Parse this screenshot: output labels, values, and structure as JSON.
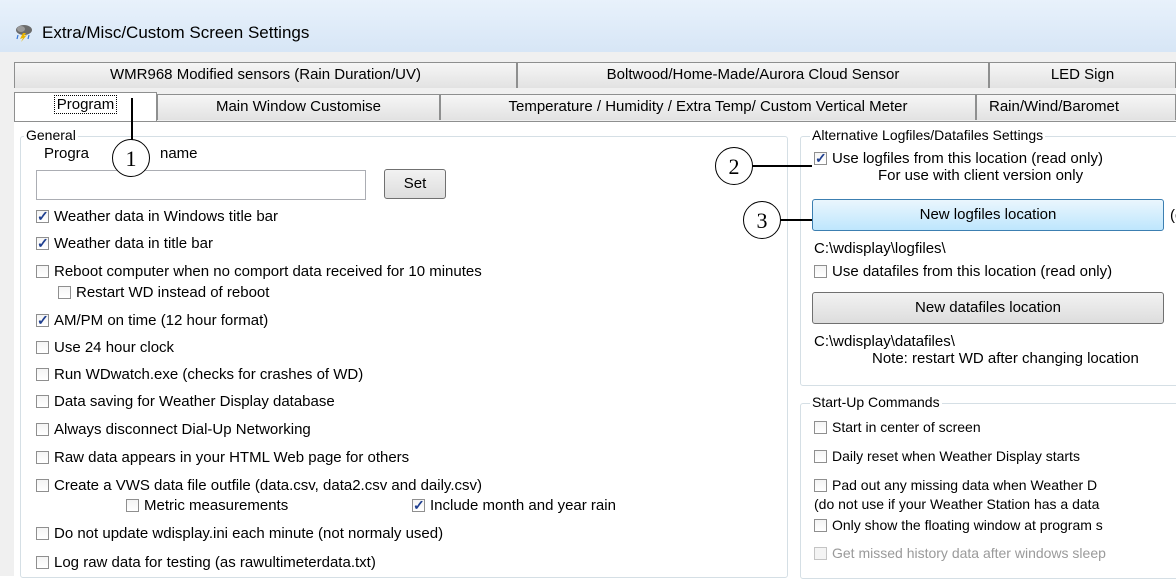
{
  "window": {
    "title": "Extra/Misc/Custom Screen Settings",
    "icon": "weather-app-icon"
  },
  "tabs_row1": [
    {
      "label": "WMR968 Modified sensors (Rain Duration/UV)"
    },
    {
      "label": "Boltwood/Home-Made/Aurora Cloud Sensor"
    },
    {
      "label": "LED Sign"
    }
  ],
  "tabs_row2": [
    {
      "label": "Program",
      "active": true
    },
    {
      "label": "Main Window Customise"
    },
    {
      "label": "Temperature / Humidity / Extra Temp/ Custom Vertical Meter"
    },
    {
      "label": "Rain/Wind/Baromet"
    }
  ],
  "general": {
    "group_label": "General",
    "program_name_label_left": "Progra",
    "program_name_label_right": "name",
    "program_name_value": "",
    "set_button": "Set",
    "options": [
      {
        "label": "Weather data in Windows title bar",
        "checked": true
      },
      {
        "label": "Weather data in title bar",
        "checked": true
      },
      {
        "label": "Reboot computer when no comport data received  for 10 minutes",
        "checked": false
      },
      {
        "label": "Restart WD instead of reboot",
        "checked": false
      },
      {
        "label": "AM/PM on time (12 hour format)",
        "checked": true
      },
      {
        "label": "Use 24 hour clock",
        "checked": false
      },
      {
        "label": "Run WDwatch.exe (checks for crashes of WD)",
        "checked": false
      },
      {
        "label": "Data saving for Weather Display database",
        "checked": false
      },
      {
        "label": "Always disconnect Dial-Up Networking",
        "checked": false
      },
      {
        "label": "Raw data appears in your HTML Web page for others",
        "checked": false
      },
      {
        "label": "Create a VWS data file outfile (data.csv, data2.csv and daily.csv)",
        "checked": false
      },
      {
        "label": "Metric measurements",
        "checked": false
      },
      {
        "label": "Include month and year rain",
        "checked": true
      },
      {
        "label": "Do not update wdisplay.ini each minute (not normaly used)",
        "checked": false
      },
      {
        "label": "Log raw data for testing (as rawultimeterdata.txt)",
        "checked": false
      }
    ]
  },
  "alt_files": {
    "group_label": "Alternative Logfiles/Datafiles Settings",
    "use_logfiles_label": "Use logfiles from this location (read only)",
    "use_logfiles_checked": true,
    "client_note": "For use with  client version only",
    "new_logfiles_button": "New logfiles location",
    "trailing_text": "(c",
    "logfiles_path": "C:\\wdisplay\\logfiles\\",
    "use_datafiles_label": "Use datafiles from this location (read only)",
    "use_datafiles_checked": false,
    "new_datafiles_button": "New datafiles location",
    "datafiles_path": "C:\\wdisplay\\datafiles\\",
    "restart_note": "Note: restart WD after changing location"
  },
  "startup": {
    "group_label": "Start-Up Commands",
    "options": [
      {
        "label": "Start in center of screen",
        "checked": false,
        "disabled": false
      },
      {
        "label": "Daily reset when Weather Display starts",
        "checked": false,
        "disabled": false
      },
      {
        "label": "Pad out any missing data when Weather D",
        "checked": false,
        "disabled": false
      }
    ],
    "note": "(do not use if your Weather Station has a data",
    "options2": [
      {
        "label": "Only show the floating window at program s",
        "checked": false,
        "disabled": false
      },
      {
        "label": "Get missed history data after windows sleep",
        "checked": false,
        "disabled": true
      }
    ]
  },
  "callouts": [
    "1",
    "2",
    "3"
  ]
}
